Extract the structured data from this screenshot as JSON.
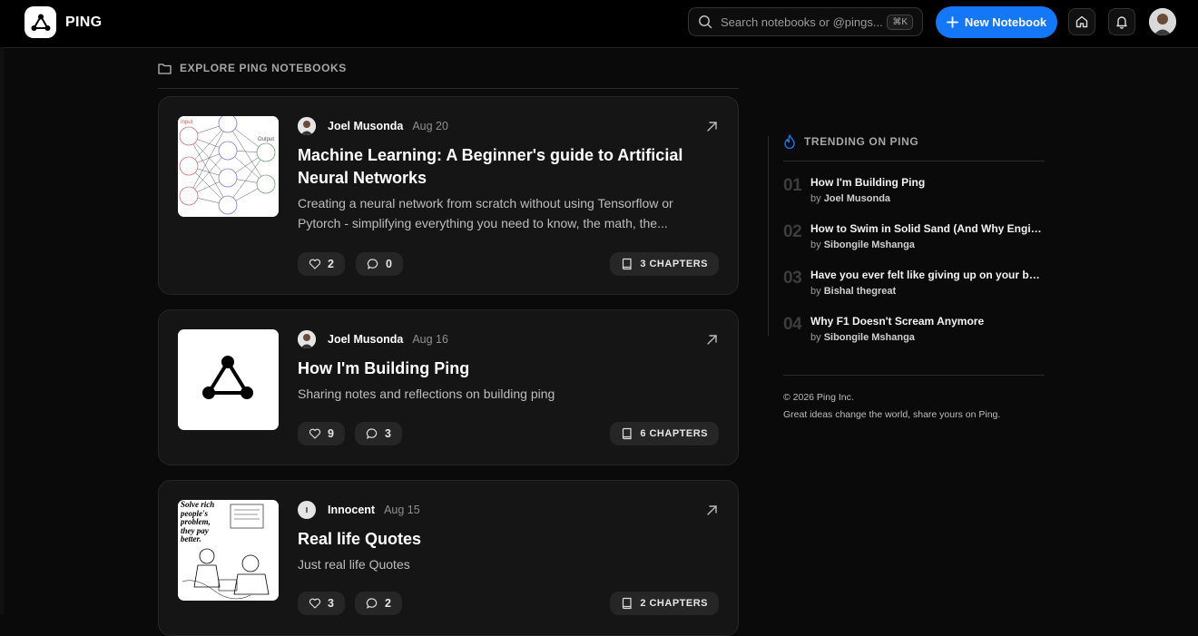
{
  "brand": {
    "name": "PING"
  },
  "search": {
    "placeholder": "Search notebooks or @pings...",
    "shortcut": "⌘K"
  },
  "header": {
    "new_notebook_label": "New Notebook"
  },
  "explore": {
    "title": "EXPLORE PING NOTEBOOKS"
  },
  "notebooks": [
    {
      "author": "Joel Musonda",
      "date": "Aug 20",
      "title": "Machine Learning: A Beginner's guide to Artificial Neural Networks",
      "description": "Creating a neural network from scratch without using Tensorflow or Pytorch - simplifying everything you need to know, the math, the...",
      "likes": "2",
      "comments": "0",
      "chapters": "3 CHAPTERS",
      "thumbnail_labels": {
        "input": "Input",
        "output": "Output"
      }
    },
    {
      "author": "Joel Musonda",
      "date": "Aug 16",
      "title": "How I'm Building Ping",
      "description": "Sharing notes and reflections on building ping",
      "likes": "9",
      "comments": "3",
      "chapters": "6 CHAPTERS"
    },
    {
      "author": "Innocent",
      "author_initial": "I",
      "date": "Aug 15",
      "title": "Real life Quotes",
      "description": "Just real life Quotes",
      "likes": "3",
      "comments": "2",
      "chapters": "2 CHAPTERS",
      "thumbnail_text": "Solve rich people's problem, they pay better."
    }
  ],
  "trending": {
    "title": "TRENDING ON PING",
    "items": [
      {
        "num": "01",
        "title": "How I'm Building Ping",
        "by_prefix": "by",
        "author": "Joel Musonda"
      },
      {
        "num": "02",
        "title": "How to Swim in Solid Sand (And Why Engineers...",
        "by_prefix": "by",
        "author": "Sibongile Mshanga"
      },
      {
        "num": "03",
        "title": "Have you ever felt like giving up on your big dreams?",
        "by_prefix": "by",
        "author": "Bishal thegreat"
      },
      {
        "num": "04",
        "title": "Why F1 Doesn't Scream Anymore",
        "by_prefix": "by",
        "author": "Sibongile Mshanga"
      }
    ]
  },
  "footer": {
    "copyright": "© 2026 Ping Inc.",
    "tagline": "Great ideas change the world, share yours on Ping."
  },
  "colors": {
    "accent": "#1477f8",
    "background": "#0a0a0a",
    "card": "#151515"
  },
  "icons": {
    "search": "search-icon",
    "home": "home-icon",
    "bell": "bell-icon",
    "folder": "folder-icon",
    "flame": "flame-icon",
    "heart": "heart-icon",
    "comment": "comment-icon",
    "book": "book-icon",
    "arrow": "arrow-up-right-icon"
  }
}
